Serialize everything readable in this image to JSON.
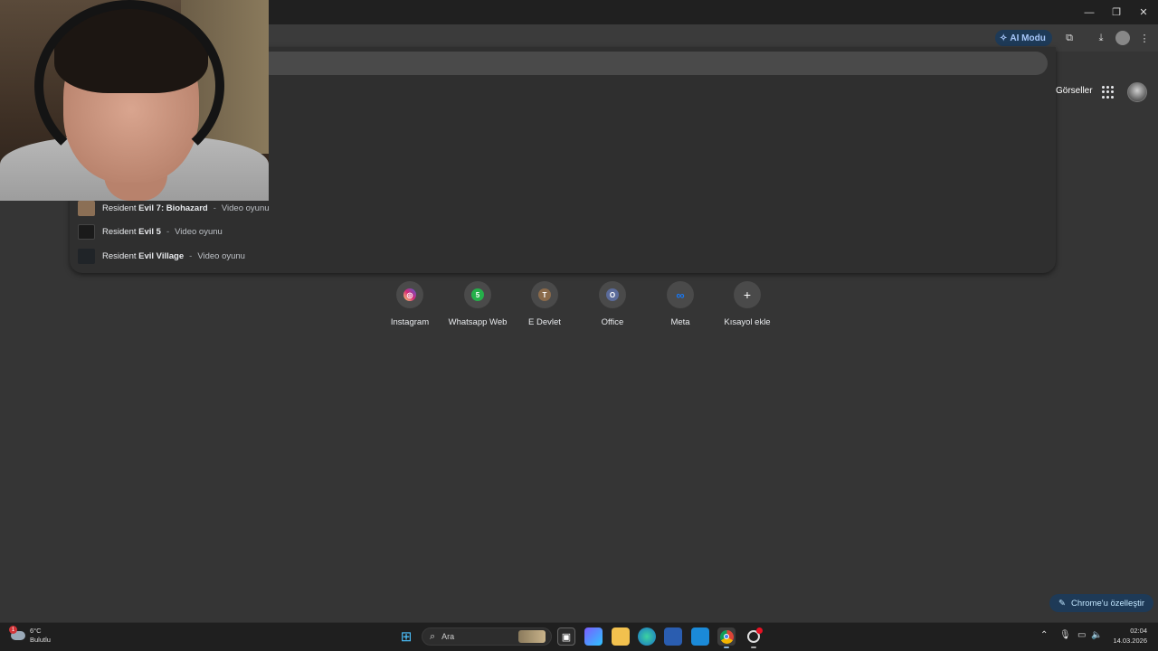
{
  "toolbar": {
    "ai_mode_label": "AI Modu"
  },
  "header": {
    "images_link": "Görseller"
  },
  "suggestions": [
    {
      "prefix": "Resident ",
      "bold": "Evil 7: Biohazard",
      "type": "Video oyunu",
      "thumb_color": "#8b6f55"
    },
    {
      "prefix": "Resident ",
      "bold": "Evil 5",
      "type": "Video oyunu",
      "thumb_color": "#1a1a1a"
    },
    {
      "prefix": "Resident ",
      "bold": "Evil Village",
      "type": "Video oyunu",
      "thumb_color": "#202428"
    }
  ],
  "separator": "-",
  "shortcuts": [
    {
      "label": "Instagram",
      "icon": "instagram-icon",
      "glyph": "◎",
      "color": "#d62976"
    },
    {
      "label": "Whatsapp Web",
      "icon": "whatsapp-icon",
      "glyph": "5",
      "color": "#25b04a"
    },
    {
      "label": "E Devlet",
      "icon": "edevlet-icon",
      "glyph": "T",
      "color": "#8a6a4a"
    },
    {
      "label": "Office",
      "icon": "office-icon",
      "glyph": "O",
      "color": "#5b6b9a"
    },
    {
      "label": "Meta",
      "icon": "meta-icon",
      "glyph": "∞",
      "color": "#3a3a3a"
    },
    {
      "label": "Kısayol ekle",
      "icon": "plus-icon",
      "glyph": "+",
      "color": "transparent"
    }
  ],
  "customize_label": "Chrome'u özelleştir",
  "taskbar": {
    "weather_temp": "6°C",
    "weather_desc": "Bulutlu",
    "weather_badge": "1",
    "search_placeholder": "Ara",
    "time": "02:04",
    "date": "14.03.2026"
  }
}
